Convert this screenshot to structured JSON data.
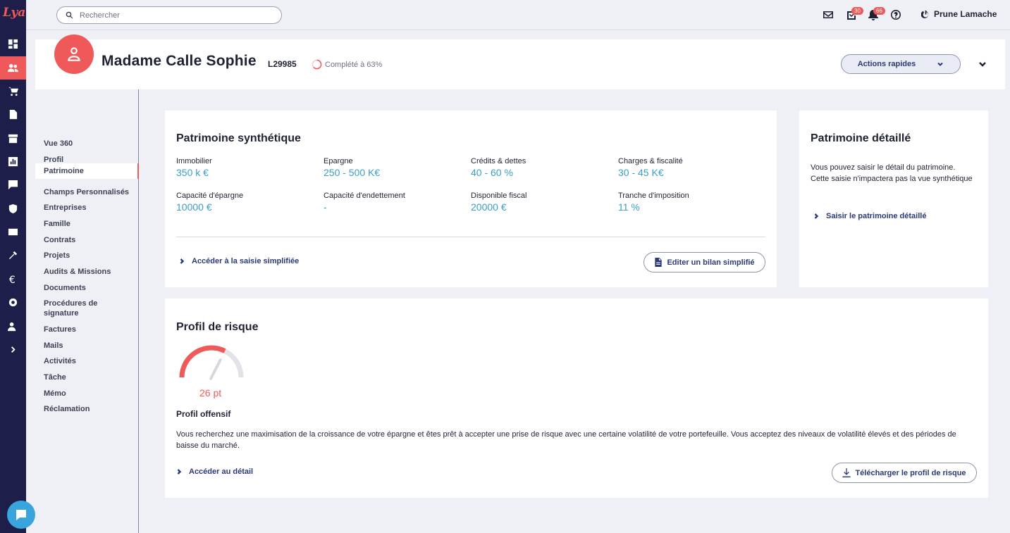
{
  "app": {
    "logo": "Lya"
  },
  "search": {
    "placeholder": "Rechercher"
  },
  "topbar": {
    "tasks_count": "30",
    "notifications_count": "66",
    "user_name": "Prune Lamache"
  },
  "client": {
    "name": "Madame Calle Sophie",
    "code": "L29985",
    "completion_label": "Complété à 63%",
    "completion_percent": 63
  },
  "quick_actions": {
    "label": "Actions rapides"
  },
  "menu": [
    "Vue 360",
    "Profil",
    "Patrimoine",
    "Champs Personnalisés",
    "Entreprises",
    "Famille",
    "Contrats",
    "Projets",
    "Audits & Missions",
    "Documents",
    "Procédures de signature",
    "Factures",
    "Mails",
    "Activités",
    "Tâche",
    "Mémo",
    "Réclamation"
  ],
  "menu_active": "Patrimoine",
  "synthetic": {
    "title": "Patrimoine synthétique",
    "fields": [
      {
        "label": "Immobilier",
        "value": "350 k €"
      },
      {
        "label": "Epargne",
        "value": "250 - 500 K€"
      },
      {
        "label": "Crédits & dettes",
        "value": "40 - 60 %"
      },
      {
        "label": "Charges & fiscalité",
        "value": "30 - 45 K€"
      },
      {
        "label": "Capacité d'épargne",
        "value": "10000 €"
      },
      {
        "label": "Capacité d'endettement",
        "value": "-"
      },
      {
        "label": "Disponible fiscal",
        "value": "20000 €"
      },
      {
        "label": "Tranche d'imposition",
        "value": "11 %"
      }
    ],
    "link_label": "Accéder à la saisie simplifiée",
    "button_label": "Editer un bilan simplifié"
  },
  "detailed": {
    "title": "Patrimoine détaillé",
    "desc_line1": "Vous pouvez saisir le détail du patrimoine.",
    "desc_line2": "Cette saisie n'impactera pas la vue synthétique",
    "link_label": "Saisir le patrimoine détaillé"
  },
  "risk": {
    "title": "Profil de risque",
    "score_label": "26 pt",
    "score": 26,
    "profile_name": "Profil offensif",
    "description": "Vous recherchez une maximisation de la croissance de votre épargne et êtes prêt à accepter une prise de risque avec une certaine volatilité de votre portefeuille. Vous acceptez des niveaux de volatilité élevés et des périodes de baisse du marché.",
    "link_label": "Accéder au détail",
    "button_label": "Télécharger le profil de risque"
  },
  "colors": {
    "accent": "#f0595a",
    "rail": "#1d1f4a",
    "value_blue": "#3a9fc9",
    "link_navy": "#2b3a75"
  }
}
